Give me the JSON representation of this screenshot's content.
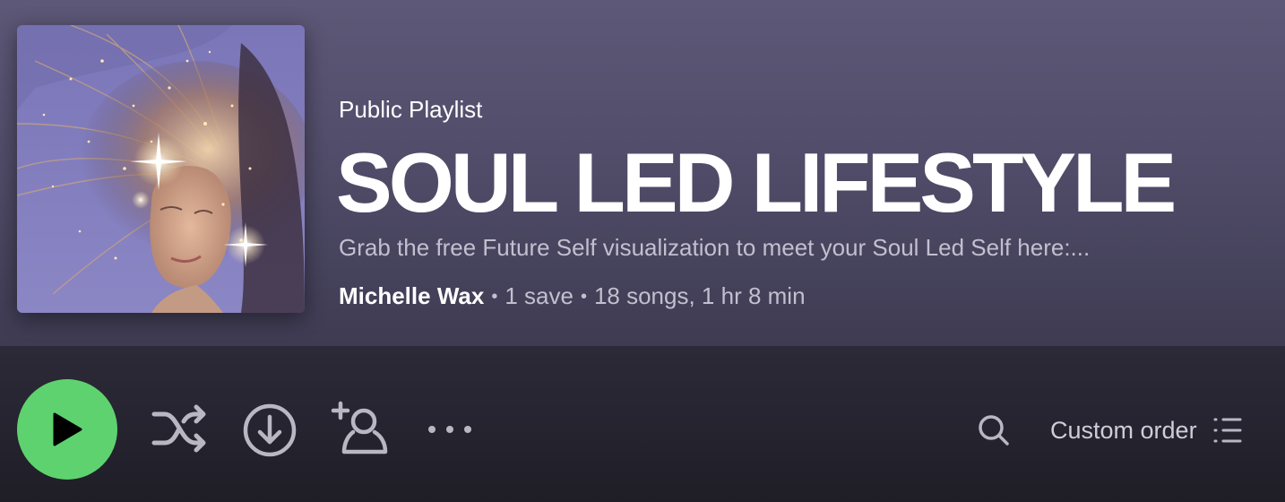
{
  "playlist": {
    "type_label": "Public Playlist",
    "title": "SOUL LED LIFESTYLE",
    "description": "Grab the free Future Self visualization to meet your Soul Led Self here:...",
    "owner": "Michelle Wax",
    "separator": "•",
    "saves": "1 save",
    "stats": "18 songs, 1 hr 8 min",
    "cover_icon": "playlist-cover-art"
  },
  "controls": {
    "play_icon": "play-icon",
    "shuffle_icon": "shuffle-icon",
    "download_icon": "download-icon",
    "add_user_icon": "add-collaborator-icon",
    "more_icon": "more-options-icon",
    "search_icon": "search-icon",
    "sort_label": "Custom order",
    "sort_icon": "list-icon"
  },
  "colors": {
    "header_top": "#5e5878",
    "header_bottom": "#3e3b52",
    "control_bar": "#23222c",
    "play_green": "#5ed26e",
    "muted_text": "#c2bfcf",
    "icon_gray": "#b9b7c2"
  }
}
